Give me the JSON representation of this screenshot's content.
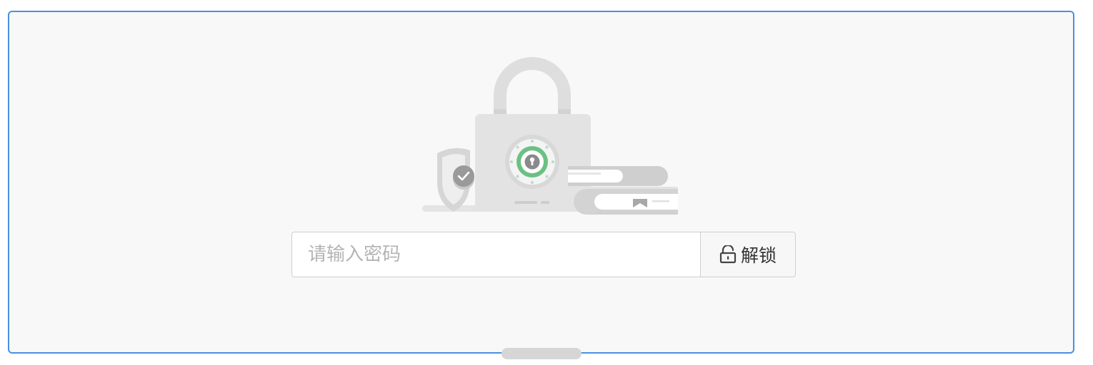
{
  "lock_screen": {
    "illustration_icon": "lock-illustration-icon",
    "password_input": {
      "placeholder": "请输入密码",
      "value": ""
    },
    "unlock_button": {
      "label": "解锁",
      "icon": "unlock-icon"
    }
  },
  "colors": {
    "frame_border": "#4a90e2",
    "panel_background": "#f8f8f8",
    "accent_green": "#6cc084",
    "illustration_gray": "#e0e0e0"
  }
}
